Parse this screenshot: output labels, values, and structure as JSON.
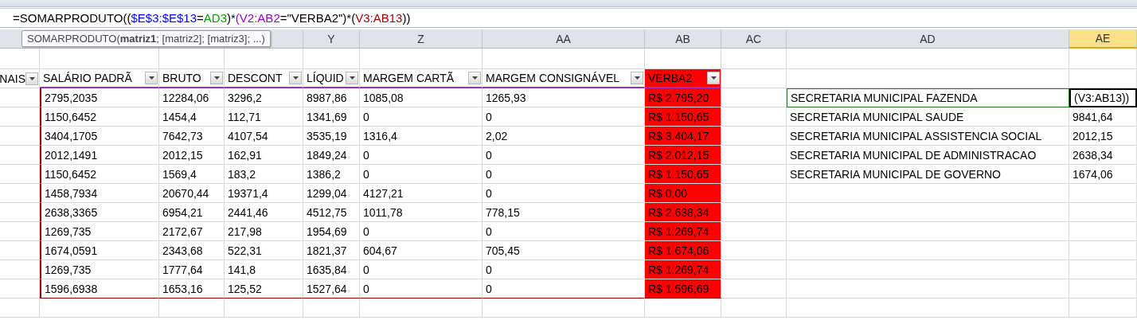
{
  "formula_bar": {
    "segments": [
      {
        "text": "=SOMARPRODUTO(("
      },
      {
        "text": "$E$3:$E$13",
        "color": "#0000ff"
      },
      {
        "text": "="
      },
      {
        "text": "AD3",
        "color": "#00a000"
      },
      {
        "text": ")*"
      },
      {
        "text": "(V2:AB2",
        "color": "#9900cc"
      },
      {
        "text": "=\"VERBA2\")*("
      },
      {
        "text": "V3:AB13",
        "color": "#990000"
      },
      {
        "text": "))"
      }
    ]
  },
  "tooltip": "SOMARPRODUTO(**matriz1**; [matriz2]; [matriz3]; ...)",
  "column_headers": [
    {
      "selected": false
    },
    {
      "selected": false
    },
    {
      "selected": false
    },
    {
      "selected": false
    },
    {
      "label": "Y",
      "selected": false
    },
    {
      "label": "Z",
      "selected": false
    },
    {
      "label": "AA",
      "selected": false
    },
    {
      "label": "AB",
      "selected": false
    },
    {
      "label": "AC",
      "selected": false
    },
    {
      "label": "AD",
      "selected": false
    },
    {
      "label": "AE",
      "selected": true
    }
  ],
  "table": {
    "columns": [
      "NAIS",
      "SALÁRIO PADRÃ",
      "BRUTO",
      "DESCONT",
      "LÍQUID",
      "MARGEM CARTÃ",
      "MARGEM CONSIGNÁVEL",
      "VERBA2"
    ],
    "rows": [
      [
        "",
        "2795,2035",
        "12284,06",
        "3296,2",
        "8987,86",
        "1085,08",
        "1265,93",
        "R$ 2.795,20"
      ],
      [
        "",
        "1150,6452",
        "1454,4",
        "112,71",
        "1341,69",
        "0",
        "0",
        "R$ 1.150,65"
      ],
      [
        "",
        "3404,1705",
        "7642,73",
        "4107,54",
        "3535,19",
        "1316,4",
        "2,02",
        "R$ 3.404,17"
      ],
      [
        "",
        "2012,1491",
        "2012,15",
        "162,91",
        "1849,24",
        "0",
        "0",
        "R$ 2.012,15"
      ],
      [
        "",
        "1150,6452",
        "1569,4",
        "183,2",
        "1386,2",
        "0",
        "0",
        "R$ 1.150,65"
      ],
      [
        "",
        "1458,7934",
        "20670,44",
        "19371,4",
        "1299,04",
        "4127,21",
        "0",
        "R$ 0,00"
      ],
      [
        "",
        "2638,3365",
        "6954,21",
        "2441,46",
        "4512,75",
        "1011,78",
        "778,15",
        "R$ 2.638,34"
      ],
      [
        "",
        "1269,735",
        "2172,67",
        "217,98",
        "1954,69",
        "0",
        "0",
        "R$ 1.269,74"
      ],
      [
        "",
        "1674,0591",
        "2343,68",
        "522,31",
        "1821,37",
        "604,67",
        "705,45",
        "R$ 1.674,06"
      ],
      [
        "",
        "1269,735",
        "1777,64",
        "141,8",
        "1635,84",
        "0",
        "0",
        "R$ 1.269,74"
      ],
      [
        "",
        "1596,6938",
        "1653,16",
        "125,52",
        "1527,64",
        "0",
        "0",
        "R$ 1.596,69"
      ]
    ]
  },
  "summary": [
    {
      "department": "SECRETARIA MUNICIPAL FAZENDA",
      "value": "(V3:AB13))",
      "selected": true
    },
    {
      "department": "SECRETARIA MUNICIPAL SAUDE",
      "value": "9841,64",
      "selected": false
    },
    {
      "department": "SECRETARIA MUNICIPAL ASSISTENCIA SOCIAL",
      "value": "2012,15",
      "selected": false
    },
    {
      "department": "SECRETARIA MUNICIPAL DE ADMINISTRACAO",
      "value": "2638,34",
      "selected": false
    },
    {
      "department": "SECRETARIA MUNICIPAL DE GOVERNO",
      "value": "1674,06",
      "selected": false
    }
  ]
}
